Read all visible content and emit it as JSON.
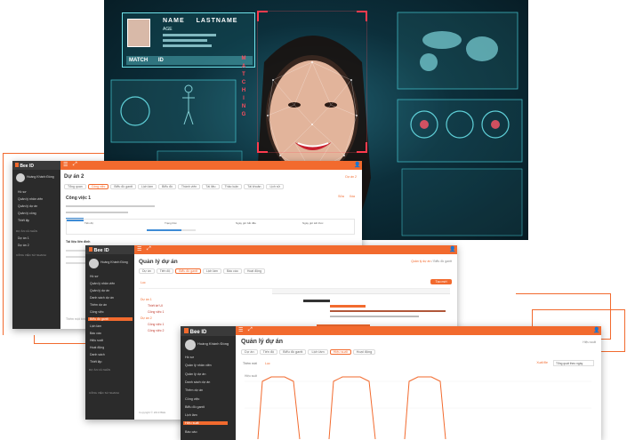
{
  "hero": {
    "card_name": "NAME",
    "card_lastname": "LASTNAME",
    "card_age": "AGE",
    "match_label": "MATCH",
    "id_label": "ID",
    "matching_text": "MATCHING",
    "colors": {
      "frame": "#ff3b4e",
      "accent": "#6fe3ea"
    }
  },
  "win1": {
    "logo": "Bee ID",
    "user_name": "Hoàng Khánh Đồng",
    "page_title": "Dự án 2",
    "breadcrumb": "Dự án 2",
    "tabs": [
      "Tổng quan",
      "Công việc",
      "Biểu đồ gantt",
      "Lịch làm",
      "Biểu đồ",
      "Thành viên",
      "Tài liệu",
      "Thảo luận",
      "Tài khoản",
      "Lịch sử"
    ],
    "task_title": "Công việc 1",
    "sidebar_items": [
      "Hồ sơ",
      "Quản lý nhân viên",
      "Quản lý dự án",
      "Quản lý công",
      "Thiết lập"
    ],
    "section_personal": "DỰ ÁN CÁ NHÂN",
    "section_tasks": "CÔNG VIỆC SỬ NHANH",
    "projects": [
      "Dự án 1",
      "Dự án 2"
    ],
    "progress_cols": [
      "Tiến độ",
      "Trạng thái",
      "Ngày giờ bắt đầu",
      "Ngày giờ kết thúc"
    ],
    "attachments_label": "Tài liệu liên đính",
    "comment_placeholder": "Thêm một bình luận",
    "actions": [
      "Sửa",
      "Xóa"
    ]
  },
  "win2": {
    "logo": "Bee ID",
    "user_name": "Hoàng Khánh Đồng",
    "page_title": "Quản lý dự án",
    "breadcrumb_home": "Quản lý dự án",
    "breadcrumb_current": "Biểu đồ gantt",
    "tabs": [
      "Dự án",
      "Tiến độ",
      "Biểu đồ gantt",
      "Lịch làm",
      "Báo cáo",
      "Hoạt động"
    ],
    "new_button": "Tạo mới",
    "filter_label": "Lọc",
    "sidebar_items": [
      "Hồ sơ",
      "Quản lý nhân viên",
      "Quản lý dự án",
      "Danh sách dự án",
      "Thêm dự án",
      "Công việc",
      "Biểu đồ gantt",
      "Lịch làm",
      "Báo cáo",
      "Hiệu suất",
      "Hoạt động",
      "Danh sách",
      "Thiết lập"
    ],
    "section_personal": "DỰ ÁN CÁ NHÂN",
    "section_tasks": "CÔNG VIỆC SỬ NHANH",
    "gantt_rows": [
      "Dự án 1",
      "Thiết kế UI",
      "Công việc 1",
      "Dự án 2",
      "Công việc 1",
      "Công việc 2"
    ],
    "footer": "Copyright © 2019 BEE"
  },
  "win3": {
    "logo": "Bee ID",
    "user_name": "Hoàng Khánh Đồng",
    "page_title": "Quản lý dự án",
    "breadcrumb_current": "Hiệu suất",
    "tabs": [
      "Dự án",
      "Tiến độ",
      "Biểu đồ gantt",
      "Lịch làm",
      "Hiệu suất",
      "Hoạt động"
    ],
    "add_button": "Thêm mới",
    "filter_label": "Lọc",
    "export_button": "Xuất file",
    "period_select": "Tổng quát theo ngày",
    "chart_label": "Hiệu suất",
    "sidebar_items": [
      "Hồ sơ",
      "Quản lý nhân viên",
      "Quản lý dự án",
      "Danh sách dự án",
      "Thêm dự án",
      "Công việc",
      "Biểu đồ gantt",
      "Lịch làm",
      "Hiệu suất",
      "Báo cáo"
    ],
    "section_personal": "DỰ ÁN CÁ NHÂN",
    "section_tasks": "CÔNG VIỆC SỬ NHANH",
    "projects": [
      "Dự án 1",
      "Dự án 2"
    ]
  },
  "colors": {
    "brand_orange": "#f26a2e",
    "sidebar_dark": "#2b2b2b",
    "accent_teal": "#6fe3ea"
  }
}
